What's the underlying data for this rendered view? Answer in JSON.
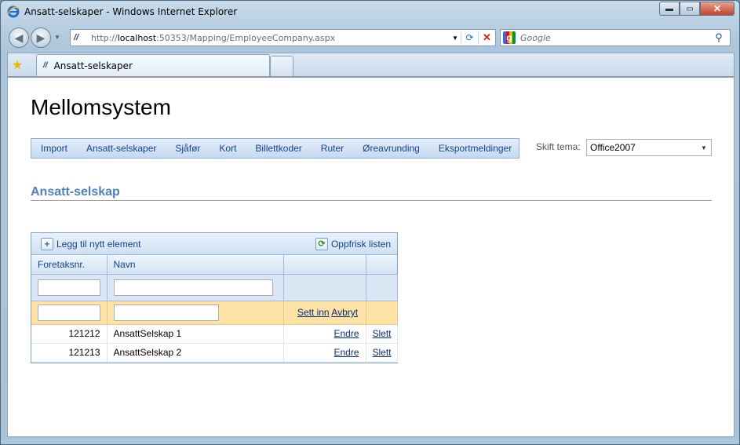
{
  "window": {
    "title": "Ansatt-selskaper - Windows Internet Explorer",
    "min_glyph": "▬",
    "max_glyph": "▭",
    "close_glyph": "✕"
  },
  "navigation": {
    "url_prefix": "http://",
    "url_host": "localhost",
    "url_rest": ":50353/Mapping/EmployeeCompany.aspx",
    "search_placeholder": "Google"
  },
  "tabs": [
    {
      "label": "Ansatt-selskaper",
      "active": true
    }
  ],
  "page": {
    "site_title": "Mellomsystem",
    "menu": [
      {
        "label": "Import"
      },
      {
        "label": "Ansatt-selskaper"
      },
      {
        "label": "Sjåfør"
      },
      {
        "label": "Kort"
      },
      {
        "label": "Billettkoder"
      },
      {
        "label": "Ruter"
      },
      {
        "label": "Øreavrunding"
      },
      {
        "label": "Eksportmeldinger"
      }
    ],
    "theme_label": "Skift tema:",
    "theme_value": "Office2007",
    "section_title": "Ansatt-selskap"
  },
  "grid": {
    "add_label": "Legg til nytt element",
    "refresh_label": "Oppfrisk listen",
    "columns": [
      "Foretaksnr.",
      "Navn",
      "",
      ""
    ],
    "insert_label": "Sett inn",
    "cancel_label": "Avbryt",
    "rows": [
      {
        "nr": "121212",
        "name": "AnsattSelskap 1",
        "edit": "Endre",
        "delete": "Slett"
      },
      {
        "nr": "121213",
        "name": "AnsattSelskap 2",
        "edit": "Endre",
        "delete": "Slett"
      }
    ]
  },
  "colors": {
    "menu_text": "#15428b",
    "section_title": "#4f81bd",
    "insert_row": "#ffe3a6"
  }
}
